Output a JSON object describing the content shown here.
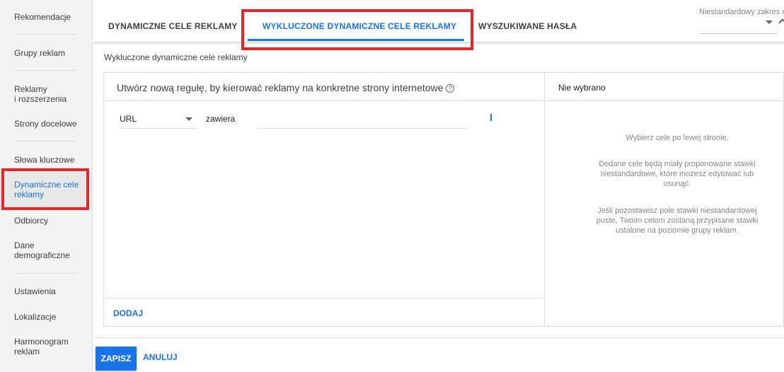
{
  "sidebar": {
    "items": [
      {
        "label": "Rekomendacje"
      },
      {
        "label": "Grupy reklam"
      },
      {
        "label": "Reklamy\ni rozszerzenia"
      },
      {
        "label": "Strony docelowe"
      },
      {
        "label": "Słowa kluczowe"
      },
      {
        "label": "Dynamiczne cele reklamy"
      },
      {
        "label": "Odbiorcy"
      },
      {
        "label": "Dane demograficzne"
      },
      {
        "label": "Ustawienia"
      },
      {
        "label": "Lokalizacje"
      },
      {
        "label": "Harmonogram reklam"
      }
    ],
    "active_index": 5
  },
  "tabs": [
    {
      "label": "DYNAMICZNE CELE REKLAMY"
    },
    {
      "label": "WYKLUCZONE DYNAMICZNE CELE REKLAMY"
    },
    {
      "label": "WYSZUKIWANE HASŁA"
    }
  ],
  "date_range": {
    "label": "Niestandardowy zakres d"
  },
  "section_label": "Wykluczone dynamiczne cele reklamy",
  "rule_panel": {
    "title": "Utwórz nową regułę, by kierować reklamy na konkretne strony internetowe",
    "help_icon": "?",
    "field_select": "URL",
    "operator": "zawiera",
    "value_input": "",
    "add_label": "DODAJ"
  },
  "selection_panel": {
    "title": "Nie wybrano",
    "messages": [
      "Wybierz cele po lewej stronie.",
      "Dodane cele będą miały proponowane stawki niestandardowe, które możesz edytować lub usunąć.",
      "Jeśli pozostawisz pole stawki niestandardowej puste, Twoim celom zostaną przypisane stawki ustalone na poziomie grupy reklam."
    ]
  },
  "actions": {
    "save_label": "ZAPISZ",
    "cancel_label": "ANULUJ"
  },
  "colors": {
    "accent": "#1a73e8",
    "highlight": "#e02828"
  }
}
